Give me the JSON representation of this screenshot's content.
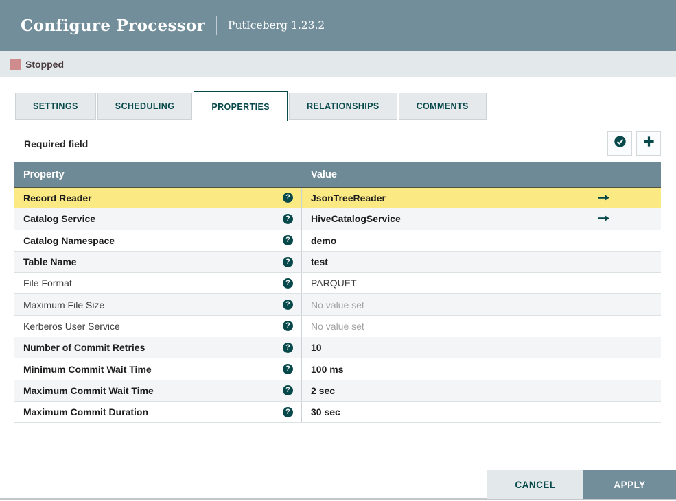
{
  "header": {
    "title": "Configure Processor",
    "subtitle": "PutIceberg 1.23.2"
  },
  "status": {
    "label": "Stopped"
  },
  "tabs": [
    {
      "label": "SETTINGS",
      "active": false
    },
    {
      "label": "SCHEDULING",
      "active": false
    },
    {
      "label": "PROPERTIES",
      "active": true
    },
    {
      "label": "RELATIONSHIPS",
      "active": false
    },
    {
      "label": "COMMENTS",
      "active": false
    }
  ],
  "toolbar": {
    "required_label": "Required field",
    "verify_icon": "check-circle",
    "add_icon": "plus"
  },
  "table": {
    "columns": [
      "Property",
      "Value"
    ],
    "help_icon": "question-circle",
    "goto_icon": "arrow-right",
    "rows": [
      {
        "property": "Record Reader",
        "value": "JsonTreeReader",
        "bold": true,
        "highlighted": true,
        "has_arrow": true,
        "no_value": false
      },
      {
        "property": "Catalog Service",
        "value": "HiveCatalogService",
        "bold": true,
        "highlighted": false,
        "has_arrow": true,
        "no_value": false
      },
      {
        "property": "Catalog Namespace",
        "value": "demo",
        "bold": true,
        "highlighted": false,
        "has_arrow": false,
        "no_value": false
      },
      {
        "property": "Table Name",
        "value": "test",
        "bold": true,
        "highlighted": false,
        "has_arrow": false,
        "no_value": false
      },
      {
        "property": "File Format",
        "value": "PARQUET",
        "bold": false,
        "highlighted": false,
        "has_arrow": false,
        "no_value": false
      },
      {
        "property": "Maximum File Size",
        "value": "No value set",
        "bold": false,
        "highlighted": false,
        "has_arrow": false,
        "no_value": true
      },
      {
        "property": "Kerberos User Service",
        "value": "No value set",
        "bold": false,
        "highlighted": false,
        "has_arrow": false,
        "no_value": true
      },
      {
        "property": "Number of Commit Retries",
        "value": "10",
        "bold": true,
        "highlighted": false,
        "has_arrow": false,
        "no_value": false
      },
      {
        "property": "Minimum Commit Wait Time",
        "value": "100 ms",
        "bold": true,
        "highlighted": false,
        "has_arrow": false,
        "no_value": false
      },
      {
        "property": "Maximum Commit Wait Time",
        "value": "2 sec",
        "bold": true,
        "highlighted": false,
        "has_arrow": false,
        "no_value": false
      },
      {
        "property": "Maximum Commit Duration",
        "value": "30 sec",
        "bold": true,
        "highlighted": false,
        "has_arrow": false,
        "no_value": false
      }
    ]
  },
  "footer": {
    "cancel": "CANCEL",
    "apply": "APPLY"
  },
  "colors": {
    "header_bg": "#728e9b",
    "accent": "#07494b",
    "stopped": "#cf8c8c",
    "highlight": "#fbe983",
    "table_header_bg": "#6f8a97",
    "status_bar_bg": "#e3e8eb"
  }
}
